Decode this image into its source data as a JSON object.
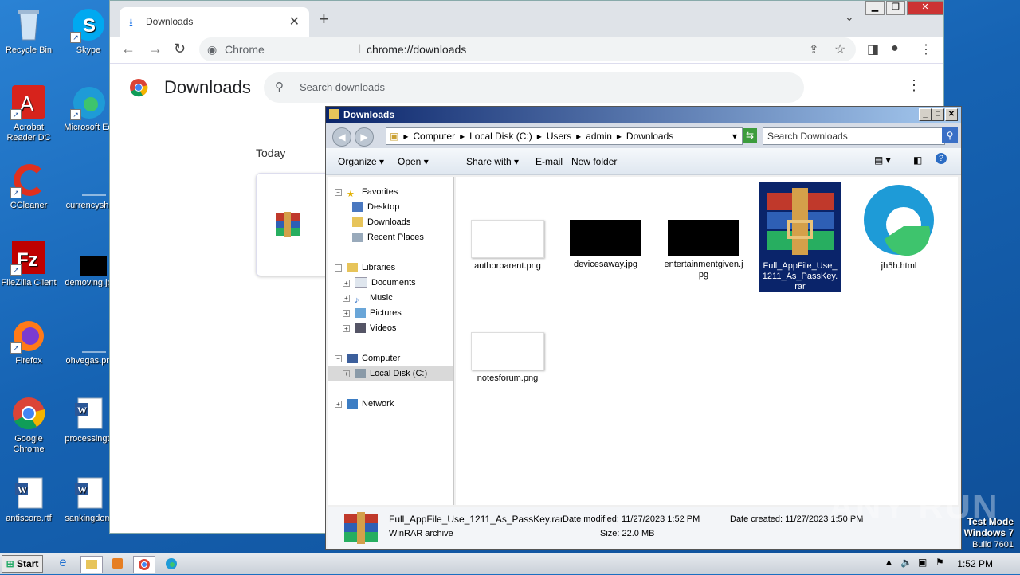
{
  "desktop": {
    "icons": [
      {
        "label": "Recycle Bin"
      },
      {
        "label": "Skype"
      },
      {
        "label": "Acrobat Reader DC"
      },
      {
        "label": "Microsoft Ed"
      },
      {
        "label": "CCleaner"
      },
      {
        "label": "currencysh."
      },
      {
        "label": "FileZilla Client"
      },
      {
        "label": "demoving.jp"
      },
      {
        "label": "Firefox"
      },
      {
        "label": "ohvegas.pn"
      },
      {
        "label": "Google Chrome"
      },
      {
        "label": "processingt."
      },
      {
        "label": "antiscore.rtf"
      },
      {
        "label": "sankingdom"
      }
    ]
  },
  "chrome": {
    "tab_title": "Downloads",
    "tab_close": "✕",
    "new_tab": "+",
    "omnibox_site": "Chrome",
    "omnibox_url": "chrome://downloads",
    "page_title": "Downloads",
    "search_placeholder": "Search downloads",
    "section_today": "Today"
  },
  "explorer": {
    "title": "Downloads",
    "breadcrumb": [
      "Computer",
      "Local Disk (C:)",
      "Users",
      "admin",
      "Downloads"
    ],
    "search_placeholder": "Search Downloads",
    "toolbar": {
      "organize": "Organize",
      "open": "Open",
      "share_with": "Share with",
      "email": "E-mail",
      "new_folder": "New folder"
    },
    "nav": {
      "favorites": "Favorites",
      "desktop": "Desktop",
      "downloads": "Downloads",
      "recent_places": "Recent Places",
      "libraries": "Libraries",
      "documents": "Documents",
      "music": "Music",
      "pictures": "Pictures",
      "videos": "Videos",
      "computer": "Computer",
      "local_disk": "Local Disk (C:)",
      "network": "Network"
    },
    "files": [
      {
        "name": "authorparent.png"
      },
      {
        "name": "devicesaway.jpg"
      },
      {
        "name": "entertainmentgiven.jpg"
      },
      {
        "name": "Full_AppFile_Use_1211_As_PassKey.rar"
      },
      {
        "name": "jh5h.html"
      },
      {
        "name": "notesforum.png"
      }
    ],
    "status": {
      "filename": "Full_AppFile_Use_1211_As_PassKey.rar",
      "type": "WinRAR archive",
      "date_modified": "Date modified: 11/27/2023 1:52 PM",
      "size": "Size: 22.0 MB",
      "date_created": "Date created: 11/27/2023 1:50 PM"
    }
  },
  "taskbar": {
    "start": "Start",
    "clock": "1:52 PM"
  },
  "watermark": {
    "line1": "Test Mode",
    "line2": "Windows 7",
    "line3": "Build 7601",
    "brand": "ANY RUN"
  }
}
